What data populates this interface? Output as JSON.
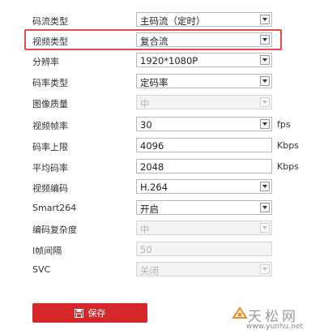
{
  "form": {
    "rows": [
      {
        "label": "码流类型",
        "value": "主码流（定时）",
        "control": "select"
      },
      {
        "label": "视频类型",
        "value": "复合流",
        "control": "select"
      },
      {
        "label": "分辨率",
        "value": "1920*1080P",
        "control": "select"
      },
      {
        "label": "码率类型",
        "value": "定码率",
        "control": "select"
      },
      {
        "label": "图像质量",
        "value": "中",
        "control": "select",
        "disabled": true
      },
      {
        "label": "视频帧率",
        "value": "30",
        "control": "select",
        "unit": "fps"
      },
      {
        "label": "码率上限",
        "value": "4096",
        "control": "text",
        "unit": "Kbps"
      },
      {
        "label": "平均码率",
        "value": "2048",
        "control": "text",
        "unit": "Kbps"
      },
      {
        "label": "视频编码",
        "value": "H.264",
        "control": "select"
      },
      {
        "label": "Smart264",
        "value": "开启",
        "control": "select"
      },
      {
        "label": "编码复杂度",
        "value": "中",
        "control": "select",
        "disabled": true
      },
      {
        "label": "I帧间隔",
        "value": "50",
        "control": "text",
        "disabled": true
      },
      {
        "label": "SVC",
        "value": "关闭",
        "control": "select",
        "disabled": true
      }
    ],
    "highlighted_row": 1
  },
  "save_button": {
    "label": "保存",
    "icon": "save-icon"
  },
  "watermark": {
    "brand": "天松网",
    "url": "www.yunhu.net"
  },
  "colors": {
    "accent": "#d6272a",
    "highlight_border": "#e14b4b"
  }
}
